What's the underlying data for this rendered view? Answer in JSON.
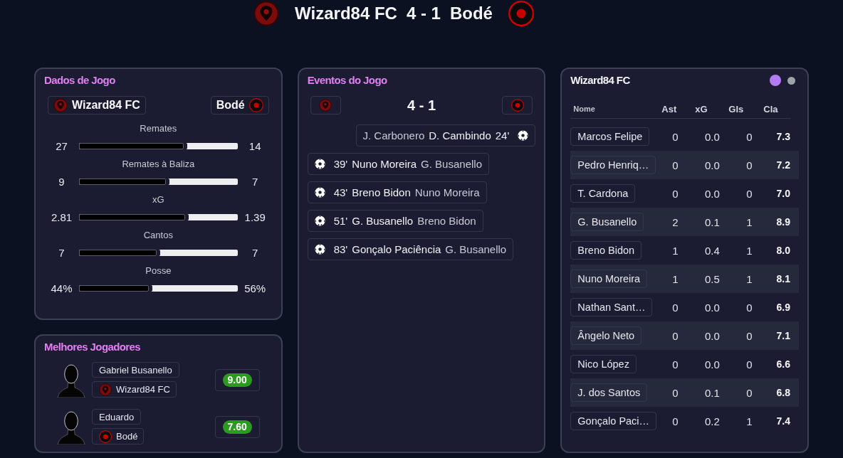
{
  "header": {
    "home_team": "Wizard84 FC",
    "score": "4 - 1",
    "away_team": "Bodé"
  },
  "match_stats": {
    "title": "Dados de Jogo",
    "home_team": "Wizard84 FC",
    "away_team": "Bodé",
    "stats": [
      {
        "label": "Remates",
        "home": "27",
        "away": "14",
        "level": 0.66
      },
      {
        "label": "Remates à Baliza",
        "home": "9",
        "away": "7",
        "level": 0.55
      },
      {
        "label": "xG",
        "home": "2.81",
        "away": "1.39",
        "level": 0.67
      },
      {
        "label": "Cantos",
        "home": "7",
        "away": "7",
        "level": 0.49
      },
      {
        "label": "Posse",
        "home": "44%",
        "away": "56%",
        "level": 0.44
      }
    ]
  },
  "best_players": {
    "title": "Melhores Jogadores",
    "players": [
      {
        "kind": "home",
        "name": "Gabriel Busanello",
        "team": "Wizard84 FC",
        "rating": "9.00"
      },
      {
        "kind": "away",
        "name": "Eduardo",
        "team": "Bodé",
        "rating": "7.60"
      }
    ]
  },
  "events": {
    "title": "Eventos do Jogo",
    "score": "4 - 1",
    "items": [
      {
        "kind": "away",
        "assist": "J. Carbonero",
        "scorer": "D. Cambindo",
        "minute": "24'"
      },
      {
        "kind": "home",
        "minute": "39'",
        "scorer": "Nuno Moreira",
        "assist": "G. Busanello"
      },
      {
        "kind": "home",
        "minute": "43'",
        "scorer": "Breno Bidon",
        "assist": "Nuno Moreira"
      },
      {
        "kind": "home",
        "minute": "51'",
        "scorer": "G. Busanello",
        "assist": "Breno Bidon"
      },
      {
        "kind": "home",
        "minute": "83'",
        "scorer": "Gonçalo Paciência",
        "assist": "G. Busanello"
      }
    ]
  },
  "lineup": {
    "title": "Wizard84 FC",
    "team_switch": [
      {
        "selected": true
      },
      {
        "selected": false
      }
    ],
    "columns": [
      "Nome",
      "Ast",
      "xG",
      "Gls",
      "Cla"
    ],
    "rows": [
      {
        "name": "Marcos Felipe",
        "ast": "0",
        "xg": "0.0",
        "gls": "0",
        "cla": "7.3"
      },
      {
        "name": "Pedro Henriq…",
        "ast": "0",
        "xg": "0.0",
        "gls": "0",
        "cla": "7.2"
      },
      {
        "name": "T. Cardona",
        "ast": "0",
        "xg": "0.0",
        "gls": "0",
        "cla": "7.0"
      },
      {
        "name": "G. Busanello",
        "ast": "2",
        "xg": "0.1",
        "gls": "1",
        "cla": "8.9"
      },
      {
        "name": "Breno Bidon",
        "ast": "1",
        "xg": "0.4",
        "gls": "1",
        "cla": "8.0"
      },
      {
        "name": "Nuno Moreira",
        "ast": "1",
        "xg": "0.5",
        "gls": "1",
        "cla": "8.1"
      },
      {
        "name": "Nathan Sant…",
        "ast": "0",
        "xg": "0.0",
        "gls": "0",
        "cla": "6.9"
      },
      {
        "name": "Ângelo Neto",
        "ast": "0",
        "xg": "0.0",
        "gls": "0",
        "cla": "7.1"
      },
      {
        "name": "Nico López",
        "ast": "0",
        "xg": "0.0",
        "gls": "0",
        "cla": "6.6"
      },
      {
        "name": "J. dos Santos",
        "ast": "0",
        "xg": "0.1",
        "gls": "0",
        "cla": "6.8"
      },
      {
        "name": "Gonçalo Paci…",
        "ast": "0",
        "xg": "0.2",
        "gls": "1",
        "cla": "7.4"
      }
    ]
  }
}
